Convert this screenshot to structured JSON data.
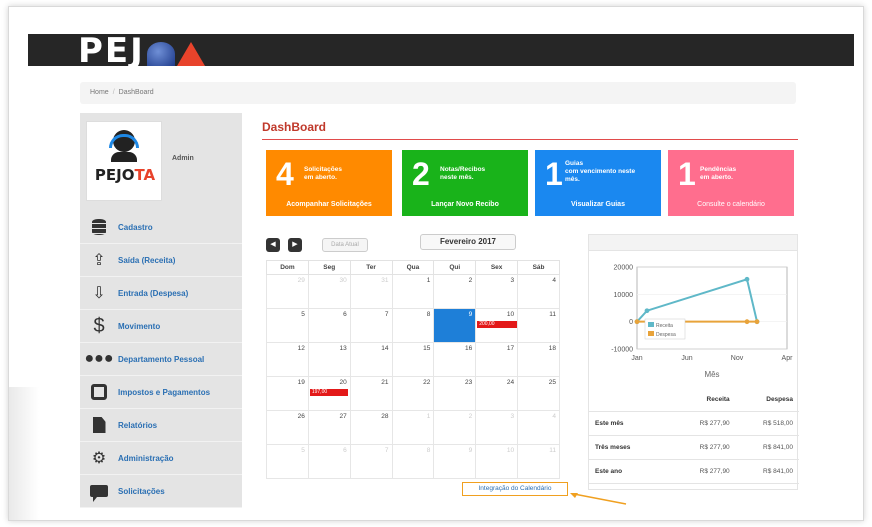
{
  "app": {
    "logo_text_left": "PEJ",
    "logo_text_right": ""
  },
  "breadcrumb": {
    "home": "Home",
    "separator": "/",
    "current": "DashBoard"
  },
  "sidebar": {
    "profile": {
      "brand_left": "PEJ",
      "brand_mid": "O",
      "brand_right": "TA",
      "name": "Admin"
    },
    "items": [
      {
        "label": "Cadastro",
        "icon": "database-icon"
      },
      {
        "label": "Saída (Receita)",
        "icon": "upload-icon"
      },
      {
        "label": "Entrada (Despesa)",
        "icon": "download-icon"
      },
      {
        "label": "Movimento",
        "icon": "dollar-icon"
      },
      {
        "label": "Departamento Pessoal",
        "icon": "users-icon"
      },
      {
        "label": "Impostos e Pagamentos",
        "icon": "inbox-icon"
      },
      {
        "label": "Relatórios",
        "icon": "report-icon"
      },
      {
        "label": "Administração",
        "icon": "gears-icon"
      },
      {
        "label": "Solicitações",
        "icon": "chat-icon"
      }
    ]
  },
  "main": {
    "title": "DashBoard",
    "tiles": [
      {
        "number": "4",
        "line1": "Solicitações",
        "line2": "em aberto.",
        "line3": "",
        "action": "Acompanhar Solicitações",
        "color": "#ff8a00"
      },
      {
        "number": "2",
        "line1": "Notas/Recibos",
        "line2": "neste mês.",
        "line3": "",
        "action": "Lançar Novo Recibo",
        "color": "#19b31a"
      },
      {
        "number": "1",
        "line1": "Guias",
        "line2": "com vencimento neste",
        "line3": "mês.",
        "action": "Visualizar Guias",
        "color": "#1a88f0"
      },
      {
        "number": "1",
        "line1": "Pendências",
        "line2": "em aberto.",
        "line3": "",
        "action": "Consulte o calendário",
        "color": "#ff6e8e"
      }
    ]
  },
  "calendar": {
    "prev_icon": "chevron-left-icon",
    "next_icon": "chevron-right-icon",
    "today_label": "Data Atual",
    "month_label": "Fevereiro 2017",
    "weekdays": [
      "Dom",
      "Seg",
      "Ter",
      "Qua",
      "Qui",
      "Sex",
      "Sáb"
    ],
    "weeks": [
      [
        {
          "d": "29",
          "o": true
        },
        {
          "d": "30",
          "o": true
        },
        {
          "d": "31",
          "o": true
        },
        {
          "d": "1"
        },
        {
          "d": "2"
        },
        {
          "d": "3"
        },
        {
          "d": "4"
        }
      ],
      [
        {
          "d": "5"
        },
        {
          "d": "6"
        },
        {
          "d": "7"
        },
        {
          "d": "8"
        },
        {
          "d": "9",
          "today": true
        },
        {
          "d": "10",
          "event": "200,00"
        },
        {
          "d": "11"
        }
      ],
      [
        {
          "d": "12"
        },
        {
          "d": "13"
        },
        {
          "d": "14"
        },
        {
          "d": "15"
        },
        {
          "d": "16"
        },
        {
          "d": "17"
        },
        {
          "d": "18"
        }
      ],
      [
        {
          "d": "19"
        },
        {
          "d": "20",
          "event": "197,00"
        },
        {
          "d": "21"
        },
        {
          "d": "22"
        },
        {
          "d": "23"
        },
        {
          "d": "24"
        },
        {
          "d": "25"
        }
      ],
      [
        {
          "d": "26"
        },
        {
          "d": "27"
        },
        {
          "d": "28"
        },
        {
          "d": "1",
          "o": true
        },
        {
          "d": "2",
          "o": true
        },
        {
          "d": "3",
          "o": true
        },
        {
          "d": "4",
          "o": true
        }
      ],
      [
        {
          "d": "5",
          "o": true
        },
        {
          "d": "6",
          "o": true
        },
        {
          "d": "7",
          "o": true
        },
        {
          "d": "8",
          "o": true
        },
        {
          "d": "9",
          "o": true
        },
        {
          "d": "10",
          "o": true
        },
        {
          "d": "11",
          "o": true
        }
      ]
    ],
    "integration_label": "Integração do Calendário"
  },
  "chart_data": {
    "type": "line",
    "x_ticks": [
      "Jan",
      "Jun",
      "Nov",
      "Apr"
    ],
    "y_ticks": [
      "20000",
      "10000",
      "0",
      "-10000"
    ],
    "ylim": [
      -10000,
      20000
    ],
    "xlabel": "Mês",
    "ylabel": "",
    "legend_position": "bottom-left",
    "series": [
      {
        "name": "Receita",
        "color": "#5fb8c8",
        "points": [
          [
            0,
            0
          ],
          [
            1,
            4000
          ],
          [
            11,
            15500
          ],
          [
            12,
            0
          ]
        ]
      },
      {
        "name": "Despesa",
        "color": "#e8a33a",
        "points": [
          [
            0,
            0
          ],
          [
            11,
            0
          ],
          [
            12,
            0
          ]
        ]
      }
    ]
  },
  "summary": {
    "headers": [
      "",
      "Receita",
      "Despesa"
    ],
    "rows": [
      [
        "Este mês",
        "R$ 277,90",
        "R$ 518,00"
      ],
      [
        "Três meses",
        "R$ 277,90",
        "R$ 841,00"
      ],
      [
        "Este ano",
        "R$ 277,90",
        "R$ 841,00"
      ]
    ]
  }
}
